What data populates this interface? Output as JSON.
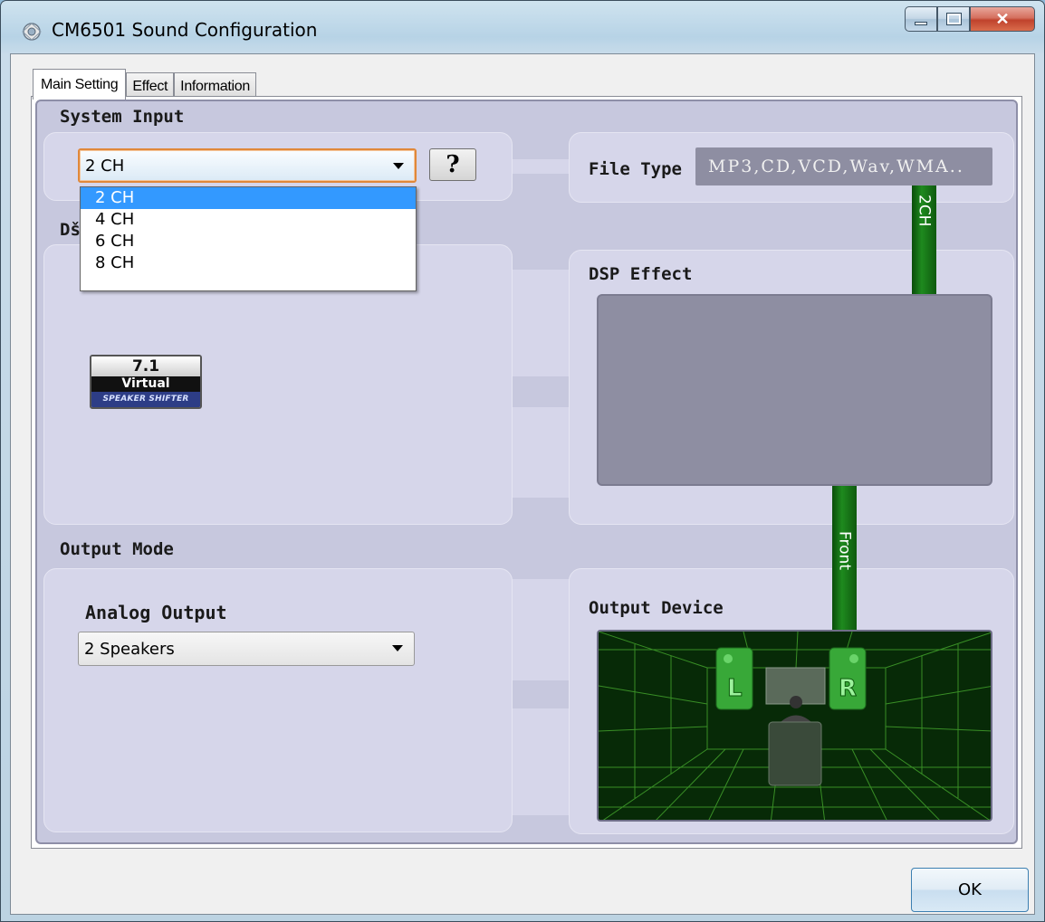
{
  "window": {
    "title": "CM6501 Sound Configuration",
    "icons": [
      "app-icon",
      "minimize-icon",
      "maximize-icon",
      "close-icon"
    ]
  },
  "tabs": [
    {
      "label": "Main Setting",
      "active": true
    },
    {
      "label": "Effect",
      "active": false
    },
    {
      "label": "Information",
      "active": false
    }
  ],
  "system_input": {
    "heading": "System Input",
    "selected": "2 CH",
    "options": [
      "2 CH",
      "4 CH",
      "6 CH",
      "8 CH"
    ],
    "highlighted_option": "2 CH",
    "help_label": "?"
  },
  "file_type": {
    "label": "File Type",
    "value": "MP3,CD,VCD,Wav,WMA.."
  },
  "dsp": {
    "heading_partial": "Dš",
    "effect_label": "DSP Effect",
    "badge": {
      "line1": "7.1",
      "line2": "Virtual",
      "line3": "SPEAKER SHIFTER"
    }
  },
  "channel_tags": {
    "input": "2CH",
    "output": "Front"
  },
  "output_mode": {
    "heading": "Output Mode",
    "analog_label": "Analog Output",
    "analog_selected": "2 Speakers"
  },
  "output_device": {
    "label": "Output Device",
    "left_speaker": "L",
    "right_speaker": "R"
  },
  "footer": {
    "ok_label": "OK"
  },
  "colors": {
    "accent_green": "#1e8a1e",
    "selection_blue": "#3399ff",
    "panel_lavender": "#c7c8de",
    "focus_orange": "#e0883a"
  }
}
